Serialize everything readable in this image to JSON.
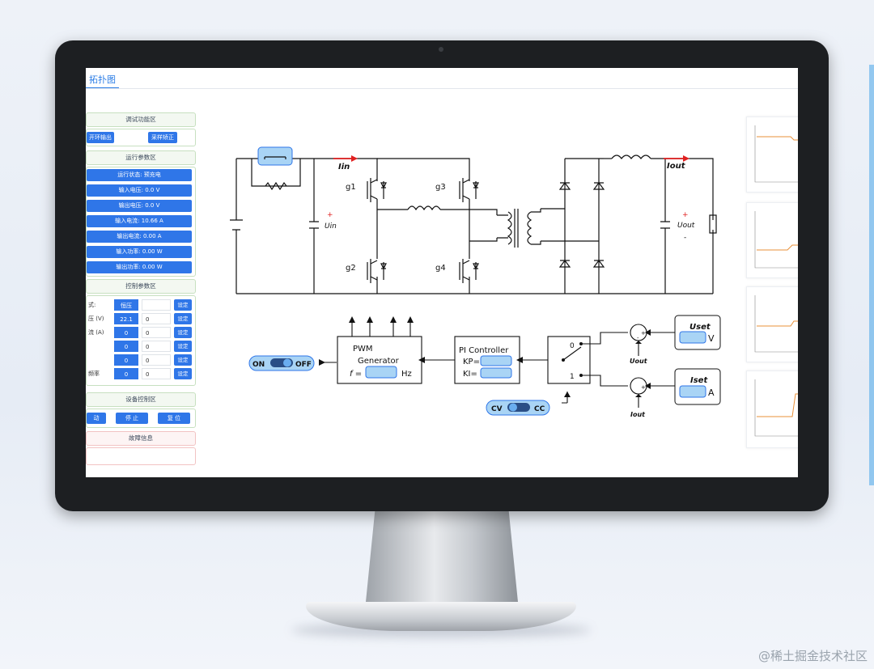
{
  "tab": {
    "label": "拓扑图"
  },
  "debug": {
    "title": "调试功能区",
    "open_loop": "开环输出",
    "calibrate": "采样矫正"
  },
  "run_params": {
    "title": "运行参数区",
    "items": [
      "运行状态: 预充电",
      "输入电压: 0.0 V",
      "输出电压: 0.0 V",
      "输入电流: 10.66 A",
      "输出电流: 0.00 A",
      "输入功率: 0.00 W",
      "输出功率: 0.00 W"
    ]
  },
  "control": {
    "title": "控制参数区",
    "rows": [
      {
        "label": "式:",
        "value": "恒压",
        "input": "",
        "btn": "设定"
      },
      {
        "label": "压 (V)",
        "value": "22.1",
        "input": "0",
        "btn": "设定"
      },
      {
        "label": "流 (A)",
        "value": "0",
        "input": "0",
        "btn": "设定"
      },
      {
        "label": "",
        "value": "0",
        "input": "0",
        "btn": "设定"
      },
      {
        "label": "",
        "value": "0",
        "input": "0",
        "btn": "设定"
      },
      {
        "label": "频率",
        "value": "0",
        "input": "0",
        "btn": "设定"
      }
    ]
  },
  "device": {
    "title": "设备控制区",
    "start": "动",
    "stop": "停  止",
    "reset": "复  位"
  },
  "fault": {
    "title": "故障信息",
    "text": ""
  },
  "diagram": {
    "Iin": "Iin",
    "Uin": "Uin",
    "Iout": "Iout",
    "Uout": "Uout",
    "g1": "g1",
    "g2": "g2",
    "g3": "g3",
    "g4": "g4",
    "pwm_line1": "PWM",
    "pwm_line2": "Generator",
    "f_label": "f =",
    "hz": "Hz",
    "pi_title": "PI Controller",
    "kp": "KP=",
    "ki": "KI=",
    "zero": "0",
    "one": "1",
    "uset": "Uset",
    "v": "V",
    "iset": "Iset",
    "a": "A",
    "uout_fb": "Uout",
    "iout_fb": "Iout",
    "on": "ON",
    "off": "OFF",
    "cv": "CV",
    "cc": "CC",
    "plus": "+",
    "minus": "-"
  },
  "watermark": "@稀土掘金技术社区",
  "colors": {
    "accent": "#2f76e8",
    "toggle_bg": "#a9d4f5",
    "arrow_red": "#e02020",
    "trace_orange": "#e8903a"
  }
}
